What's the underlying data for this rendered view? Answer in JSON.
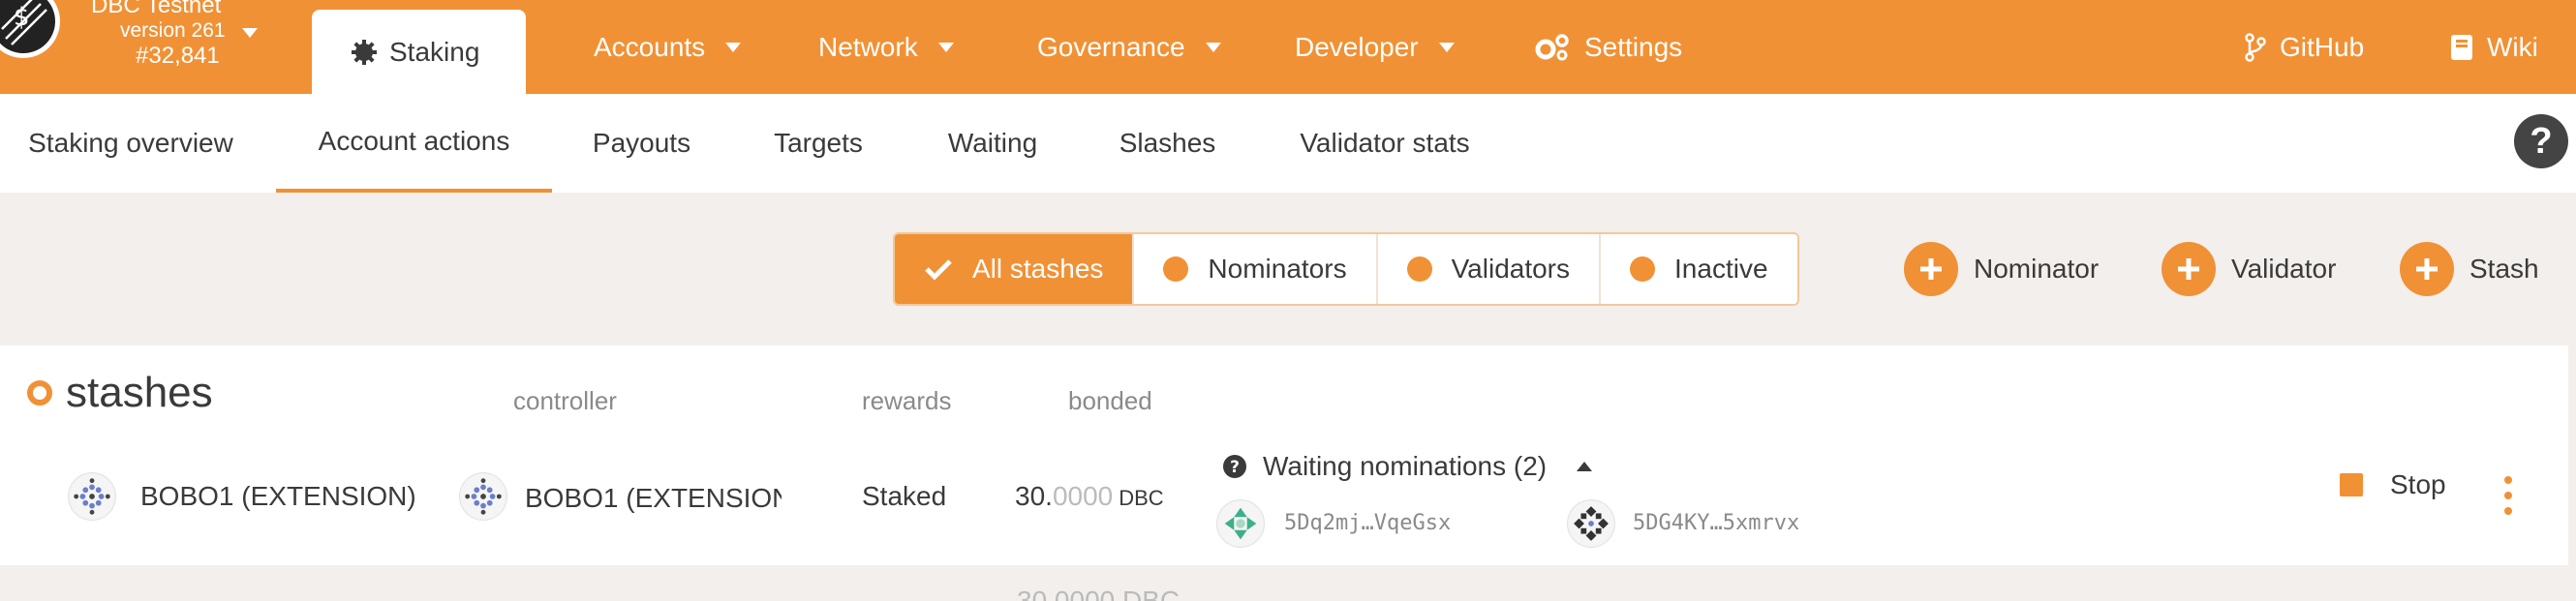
{
  "header": {
    "chain_name": "DBC Testnet",
    "version": "version 261",
    "block": "#32,841",
    "active_tab": "Staking",
    "nav": [
      {
        "label": "Accounts"
      },
      {
        "label": "Network"
      },
      {
        "label": "Governance"
      },
      {
        "label": "Developer"
      },
      {
        "label": "Settings"
      }
    ],
    "links": [
      {
        "label": "GitHub"
      },
      {
        "label": "Wiki"
      }
    ]
  },
  "subtabs": [
    {
      "label": "Staking overview"
    },
    {
      "label": "Account actions",
      "active": true
    },
    {
      "label": "Payouts"
    },
    {
      "label": "Targets"
    },
    {
      "label": "Waiting"
    },
    {
      "label": "Slashes"
    },
    {
      "label": "Validator stats"
    }
  ],
  "filters": [
    {
      "label": "All stashes",
      "active": true
    },
    {
      "label": "Nominators"
    },
    {
      "label": "Validators"
    },
    {
      "label": "Inactive"
    }
  ],
  "actions": {
    "nominator": "Nominator",
    "validator": "Validator",
    "stash": "Stash"
  },
  "table": {
    "title": "stashes",
    "headers": {
      "controller": "controller",
      "rewards": "rewards",
      "bonded": "bonded"
    },
    "row": {
      "stash": "BOBO1 (EXTENSION)",
      "controller": "BOBO1 (EXTENSION",
      "rewards": "Staked",
      "bonded_int": "30.",
      "bonded_dec": "0000",
      "bonded_unit": "DBC",
      "nominations_label": "Waiting nominations (2)",
      "nominees": [
        "5Dq2mj…VqeGsx",
        "5DG4KY…5xmrvx"
      ],
      "stop": "Stop"
    },
    "next_row_bonded": "30.0000 DBC"
  },
  "colors": {
    "accent": "#f19135",
    "text": "#3a3a3a",
    "muted": "#8a8a8a",
    "background": "#f2efec"
  }
}
